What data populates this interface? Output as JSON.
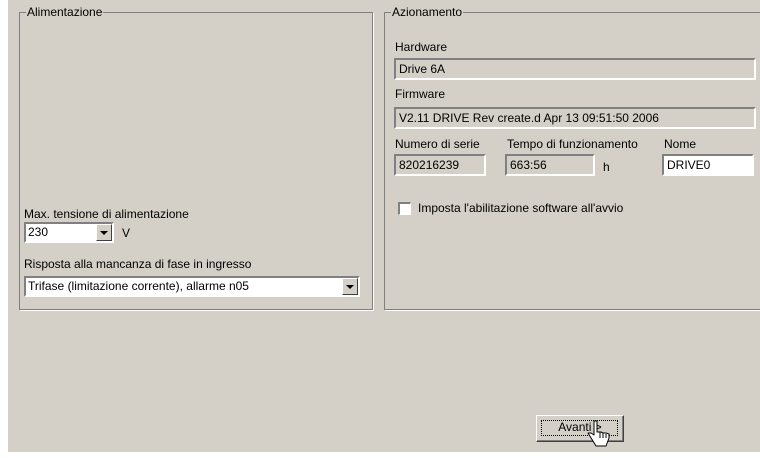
{
  "alimentazione": {
    "legend": "Alimentazione",
    "max_voltage_label": "Max. tensione di alimentazione",
    "max_voltage_value": "230",
    "max_voltage_unit": "V",
    "phase_loss_label": "Risposta alla mancanza di fase in ingresso",
    "phase_loss_value": "Trifase (limitazione corrente), allarme n05"
  },
  "azionamento": {
    "legend": "Azionamento",
    "hardware_label": "Hardware",
    "hardware_value": "Drive 6A",
    "firmware_label": "Firmware",
    "firmware_value": "V2.11 DRIVE Rev create.d Apr 13 09:51:50 2006",
    "serial_label": "Numero di serie",
    "serial_value": "820216239",
    "runtime_label": "Tempo di funzionamento",
    "runtime_value": "663:56",
    "runtime_unit": "h",
    "name_label": "Nome",
    "name_value": "DRIVE0",
    "enable_label": "Imposta l'abilitazione software all'avvio",
    "enable_checked": false
  },
  "footer": {
    "next_label": "Avanti >"
  },
  "icons": {
    "cursor": "mouse-pointer-icon",
    "dropdown": "chevron-down-icon"
  }
}
